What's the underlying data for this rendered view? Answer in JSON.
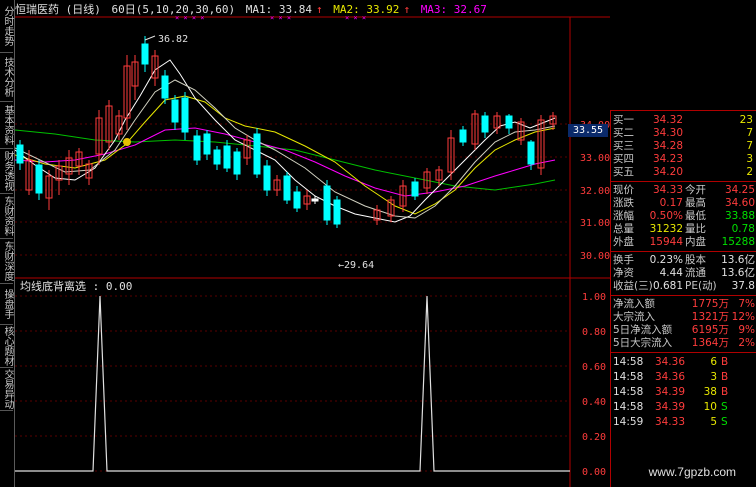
{
  "side_tabs": [
    "分时走势",
    "技术分析",
    "基本资料",
    "财务透视",
    "东财资料",
    "东财深度",
    "操盘手",
    "核心题材",
    "交易异动"
  ],
  "header": {
    "stock": "恒瑞医药 (日线)",
    "period": "60日(5,10,20,30,60)",
    "ma1": "MA1: 33.84",
    "ma2": "MA2: 33.92",
    "ma3": "MA3: 32.67"
  },
  "price_axis": [
    "34.00",
    "33.00",
    "32.00",
    "31.00",
    "30.00"
  ],
  "current_price": "33.55",
  "high_annotation": "36.82",
  "low_annotation": "←29.64",
  "indicator": {
    "title": "均线底背离选 : 0.00",
    "axis": [
      "1.00",
      "0.80",
      "0.60",
      "0.40",
      "0.20",
      "0.00"
    ]
  },
  "colors": {
    "up": "#ff3c3c",
    "down": "#00ffff",
    "ma1": "#ffffff",
    "ma2": "#e8e800",
    "ma3": "#ff00ff",
    "ma4": "#00c000"
  },
  "quote": {
    "bids": [
      {
        "label": "买一",
        "price": "34.32",
        "vol": "23"
      },
      {
        "label": "买二",
        "price": "34.30",
        "vol": "7"
      },
      {
        "label": "买三",
        "price": "34.28",
        "vol": "7"
      },
      {
        "label": "买四",
        "price": "34.23",
        "vol": "3"
      },
      {
        "label": "买五",
        "price": "34.20",
        "vol": "2"
      }
    ],
    "stats": [
      {
        "l1": "现价",
        "v1": "34.33",
        "l2": "今开",
        "v2": "34.25"
      },
      {
        "l1": "涨跌",
        "v1": "0.17",
        "l2": "最高",
        "v2": "34.60"
      },
      {
        "l1": "涨幅",
        "v1": "0.50%",
        "l2": "最低",
        "v2": "33.88"
      },
      {
        "l1": "总量",
        "v1": "31232",
        "l2": "量比",
        "v2": "0.78"
      },
      {
        "l1": "外盘",
        "v1": "15944",
        "l2": "内盘",
        "v2": "15288"
      }
    ],
    "stats2": [
      {
        "l1": "换手",
        "v1": "0.23%",
        "l2": "股本",
        "v2": "13.6亿"
      },
      {
        "l1": "净资",
        "v1": "4.44",
        "l2": "流通",
        "v2": "13.6亿"
      },
      {
        "l1": "收益(三)",
        "v1": "0.681",
        "l2": "PE(动)",
        "v2": "37.8"
      }
    ],
    "flows": [
      {
        "label": "净流入额",
        "v": "1775万",
        "p": "7%"
      },
      {
        "label": "大宗流入",
        "v": "1321万",
        "p": "12%"
      },
      {
        "label": "5日净流入额",
        "v": "6195万",
        "p": "9%"
      },
      {
        "label": "5日大宗流入",
        "v": "1364万",
        "p": "2%"
      }
    ],
    "ticks": [
      {
        "t": "14:58",
        "p": "34.36",
        "n": "6",
        "s": "B"
      },
      {
        "t": "14:58",
        "p": "34.36",
        "n": "3",
        "s": "B"
      },
      {
        "t": "14:58",
        "p": "34.39",
        "n": "38",
        "s": "B"
      },
      {
        "t": "14:58",
        "p": "34.39",
        "n": "10",
        "s": "S"
      },
      {
        "t": "14:59",
        "p": "34.33",
        "n": "5",
        "s": "S"
      }
    ]
  },
  "watermark": "www.7gpzb.com"
}
